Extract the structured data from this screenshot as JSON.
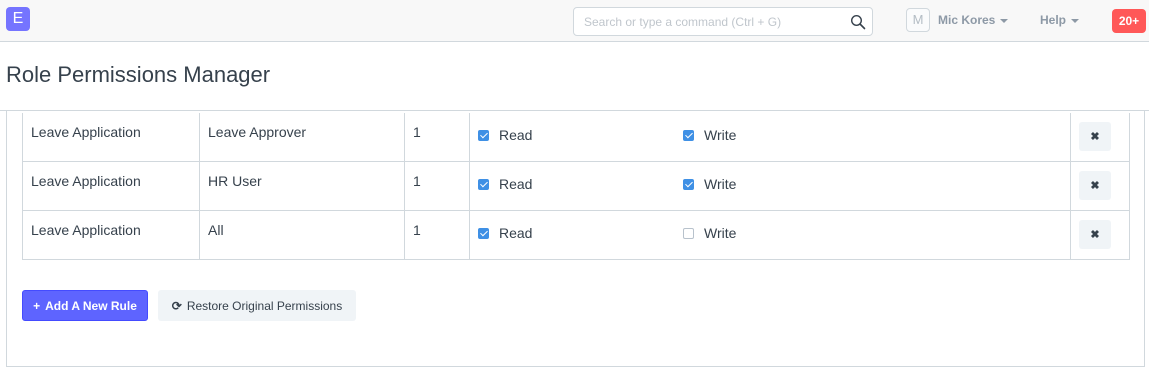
{
  "navbar": {
    "logo_letter": "E",
    "search_placeholder": "Search or type a command (Ctrl + G)",
    "avatar_initial": "M",
    "user_name": "Mic Kores",
    "help_label": "Help",
    "notification_count": "20+"
  },
  "page": {
    "title": "Role Permissions Manager"
  },
  "rules": [
    {
      "document": "Leave Application",
      "role": "Leave Approver",
      "level": "1",
      "read_label": "Read",
      "read": true,
      "write_label": "Write",
      "write": true,
      "delete_glyph": "✖"
    },
    {
      "document": "Leave Application",
      "role": "HR User",
      "level": "1",
      "read_label": "Read",
      "read": true,
      "write_label": "Write",
      "write": true,
      "delete_glyph": "✖"
    },
    {
      "document": "Leave Application",
      "role": "All",
      "level": "1",
      "read_label": "Read",
      "read": true,
      "write_label": "Write",
      "write": false,
      "delete_glyph": "✖"
    }
  ],
  "actions": {
    "add_rule_icon": "+",
    "add_rule_label": "Add A New Rule",
    "restore_icon": "⟳",
    "restore_label": "Restore Original Permissions"
  },
  "colors": {
    "primary": "#5e64ff",
    "logo": "#7574ff",
    "notification": "#ff5858",
    "checkbox": "#3f90e5"
  }
}
